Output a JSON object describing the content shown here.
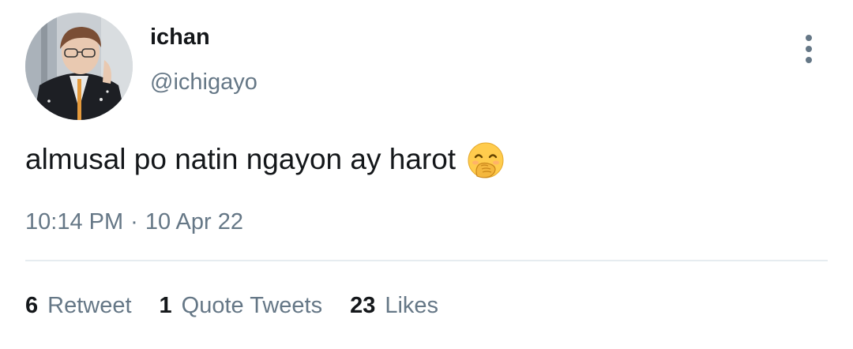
{
  "tweet": {
    "author": {
      "display_name": "ichan",
      "handle": "@ichigayo"
    },
    "text": "almusal po natin ngayon ay harot",
    "emoji_icon": "face-with-hand-over-mouth-emoji",
    "time": "10:14 PM",
    "separator": "·",
    "date": "10 Apr 22",
    "stats": {
      "retweets": {
        "count": "6",
        "label": "Retweet"
      },
      "quotes": {
        "count": "1",
        "label": "Quote Tweets"
      },
      "likes": {
        "count": "23",
        "label": "Likes"
      }
    }
  },
  "colors": {
    "primary_text": "#14171a",
    "secondary_text": "#657786",
    "divider": "#e6ecf0"
  }
}
